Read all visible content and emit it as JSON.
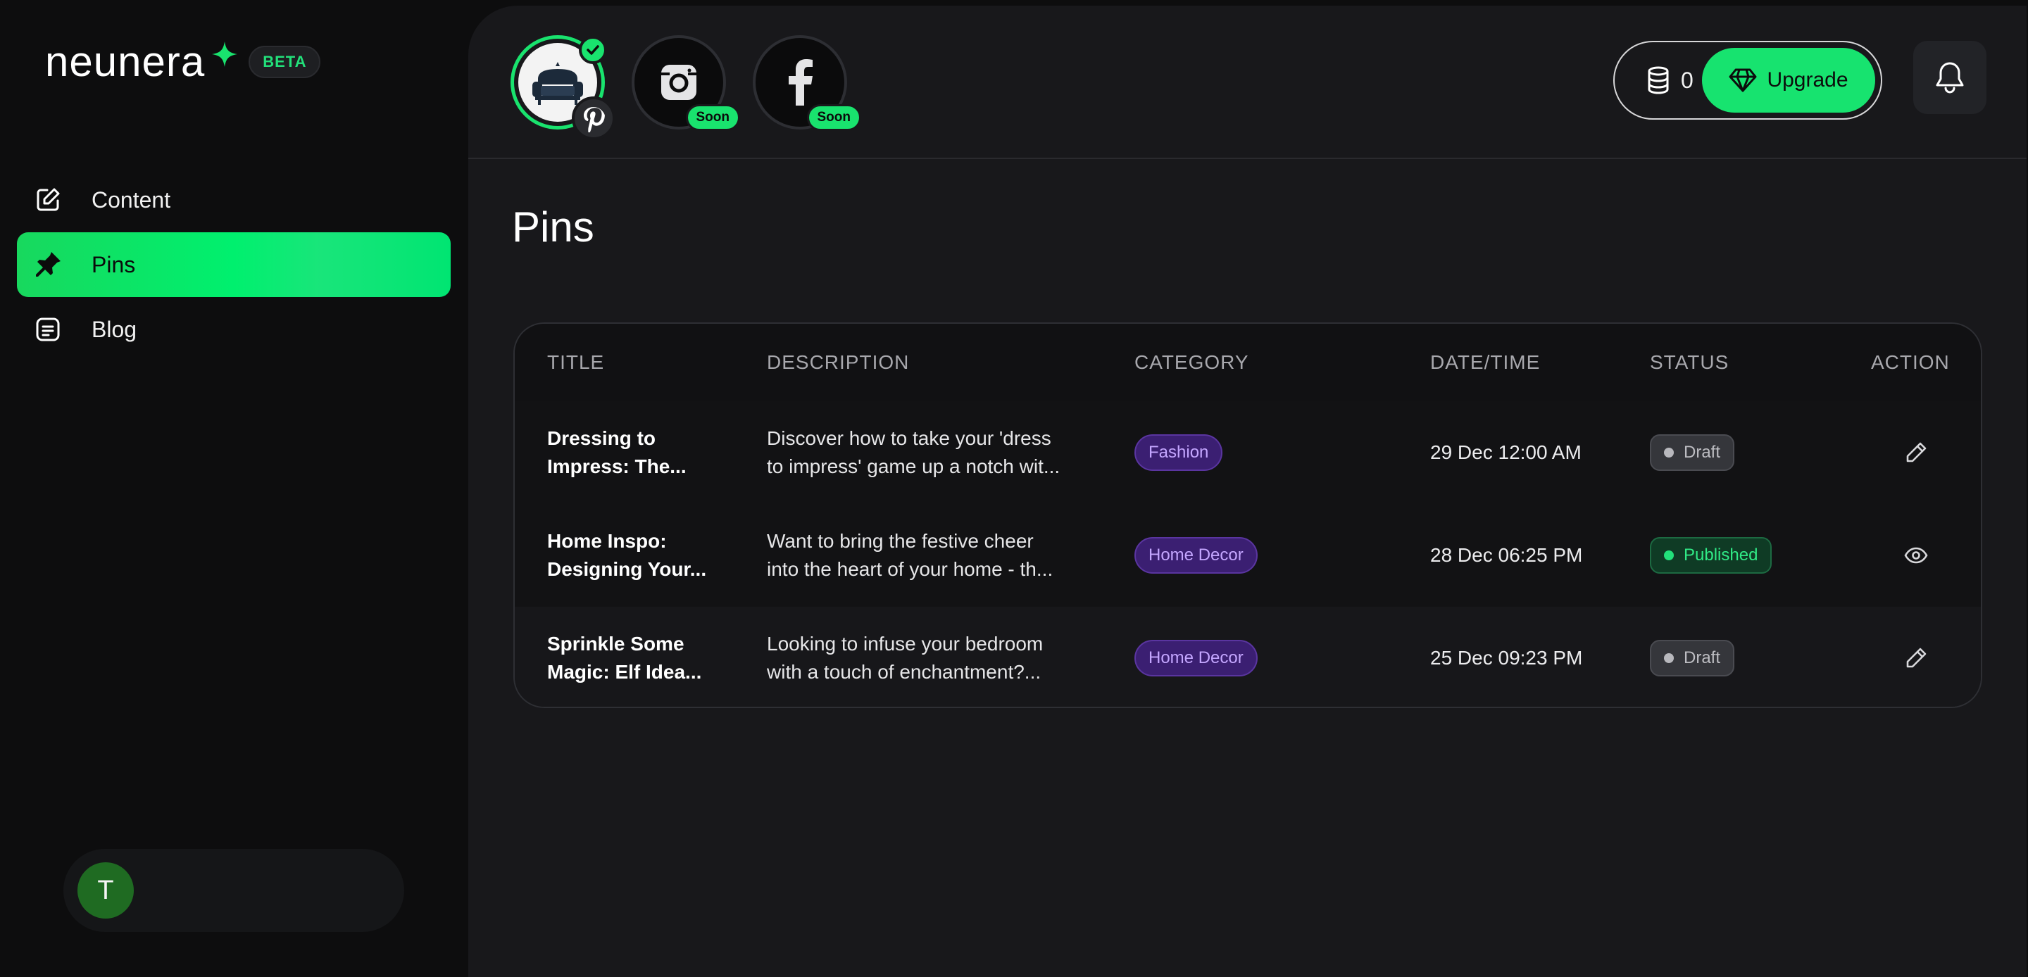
{
  "brand": {
    "name": "neunera",
    "badge": "BETA"
  },
  "nav": [
    {
      "label": "Content",
      "icon": "edit-icon",
      "active": false
    },
    {
      "label": "Pins",
      "icon": "pin-icon",
      "active": true
    },
    {
      "label": "Blog",
      "icon": "document-icon",
      "active": false
    }
  ],
  "user": {
    "initial": "T"
  },
  "channels": {
    "instagram_badge": "Soon",
    "facebook_badge": "Soon"
  },
  "credits": {
    "count": "0",
    "upgrade_label": "Upgrade"
  },
  "page": {
    "title": "Pins"
  },
  "table": {
    "headers": [
      "TITLE",
      "DESCRIPTION",
      "CATEGORY",
      "DATE/TIME",
      "STATUS",
      "ACTION"
    ],
    "rows": [
      {
        "title_l1": "Dressing to",
        "title_l2": "Impress: The...",
        "desc_l1": "Discover how to take your 'dress",
        "desc_l2": "to impress' game up a notch wit...",
        "category": "Fashion",
        "datetime": "29 Dec 12:00 AM",
        "status": "Draft",
        "action": "pencil-icon"
      },
      {
        "title_l1": "Home Inspo:",
        "title_l2": "Designing Your...",
        "desc_l1": "Want to bring the festive cheer",
        "desc_l2": "into the heart of your home - th...",
        "category": "Home Decor",
        "datetime": "28 Dec 06:25 PM",
        "status": "Published",
        "action": "eye-icon"
      },
      {
        "title_l1": "Sprinkle Some",
        "title_l2": "Magic: Elf Idea...",
        "desc_l1": "Looking to infuse your bedroom",
        "desc_l2": "with a touch of enchantment?...",
        "category": "Home Decor",
        "datetime": "25 Dec 09:23 PM",
        "status": "Draft",
        "action": "pencil-icon"
      }
    ]
  },
  "colors": {
    "accent": "#17e36f",
    "panel": "#18181b",
    "sidebar": "#0d0d0e",
    "tag_purple": "#3b1f72",
    "published_green": "#22e07a"
  }
}
